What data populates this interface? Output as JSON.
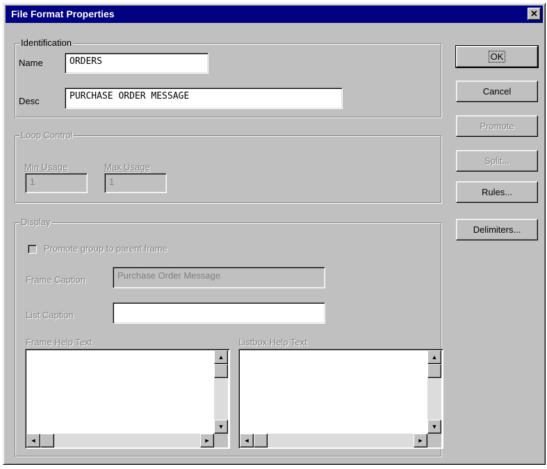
{
  "window": {
    "title": "File Format Properties",
    "close_icon": "close-icon"
  },
  "identification": {
    "legend": "Identification",
    "name_label": "Name",
    "name_value": "ORDERS",
    "desc_label": "Desc",
    "desc_value": "PURCHASE ORDER MESSAGE"
  },
  "loop_control": {
    "legend": "Loop Control",
    "min_label": "Min Usage",
    "min_value": "1",
    "max_label": "Max Usage",
    "max_value": "1"
  },
  "display": {
    "legend": "Display",
    "promote_label": "Promote group to parent frame",
    "promote_checked": false,
    "frame_caption_label": "Frame Caption",
    "frame_caption_value": "Purchase Order Message",
    "list_caption_label": "List Caption",
    "list_caption_value": "",
    "frame_help_label": "Frame Help Text",
    "listbox_help_label": "Listbox Help Text"
  },
  "buttons": {
    "ok": "OK",
    "cancel": "Cancel",
    "promote": "Promote",
    "split": "Split...",
    "rules": "Rules...",
    "delimiters": "Delimiters..."
  },
  "icons": {
    "scroll_up": "▲",
    "scroll_down": "▼",
    "scroll_left": "◄",
    "scroll_right": "►"
  },
  "colors": {
    "titlebar": "#000080",
    "face": "#c0c0c0",
    "disabled_text": "#808080"
  }
}
